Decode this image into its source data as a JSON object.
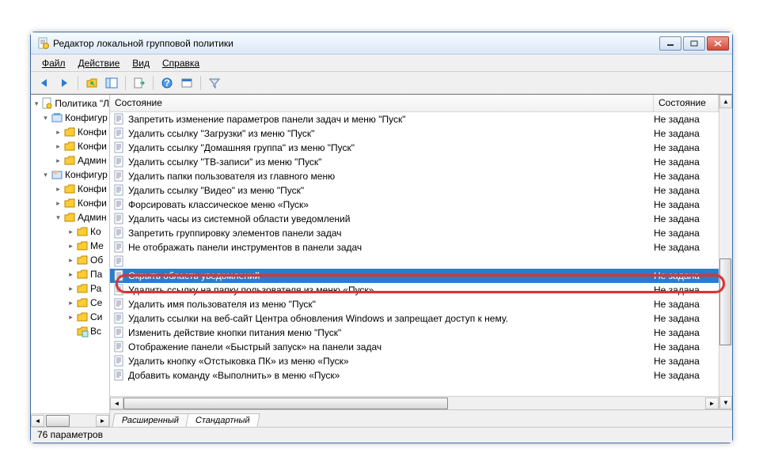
{
  "window": {
    "title": "Редактор локальной групповой политики"
  },
  "menu": {
    "file": "Файл",
    "action": "Действие",
    "view": "Вид",
    "help": "Справка"
  },
  "icons": {
    "back": "back",
    "fwd": "fwd",
    "up": "up",
    "props": "props",
    "refresh": "refresh",
    "export": "export",
    "help": "help",
    "run": "run",
    "filter": "filter"
  },
  "tree": {
    "root": "Политика \"Л",
    "nodes": [
      {
        "level": 1,
        "exp": "▾",
        "icon": "cfg",
        "label": "Конфигур"
      },
      {
        "level": 2,
        "exp": "▸",
        "icon": "folder",
        "label": "Конфи"
      },
      {
        "level": 2,
        "exp": "▸",
        "icon": "folder",
        "label": "Конфи"
      },
      {
        "level": 2,
        "exp": "▸",
        "icon": "folder",
        "label": "Админ"
      },
      {
        "level": 1,
        "exp": "▾",
        "icon": "cfg2",
        "label": "Конфигур"
      },
      {
        "level": 2,
        "exp": "▸",
        "icon": "folder",
        "label": "Конфи"
      },
      {
        "level": 2,
        "exp": "▸",
        "icon": "folder",
        "label": "Конфи"
      },
      {
        "level": 2,
        "exp": "▾",
        "icon": "folder",
        "label": "Админ"
      },
      {
        "level": 3,
        "exp": "▸",
        "icon": "folder",
        "label": "Ко"
      },
      {
        "level": 3,
        "exp": "▸",
        "icon": "folder",
        "label": "Ме"
      },
      {
        "level": 3,
        "exp": "▸",
        "icon": "folder",
        "label": "Об"
      },
      {
        "level": 3,
        "exp": "▸",
        "icon": "folder",
        "label": "Па"
      },
      {
        "level": 3,
        "exp": "▸",
        "icon": "folder",
        "label": "Ра"
      },
      {
        "level": 3,
        "exp": "▸",
        "icon": "folder",
        "label": "Се"
      },
      {
        "level": 3,
        "exp": "▸",
        "icon": "folder",
        "label": "Си"
      },
      {
        "level": 3,
        "exp": "",
        "icon": "folderx",
        "label": "Вс"
      }
    ]
  },
  "list": {
    "col_name": "Состояние",
    "col_state": "Состояние",
    "rows": [
      {
        "name": "Запретить изменение параметров панели задач и меню \"Пуск\"",
        "state": "Не задана"
      },
      {
        "name": "Удалить ссылку \"Загрузки\" из меню \"Пуск\"",
        "state": "Не задана"
      },
      {
        "name": "Удалить ссылку \"Домашняя группа\" из меню \"Пуск\"",
        "state": "Не задана"
      },
      {
        "name": "Удалить ссылку \"ТВ-записи\" из меню \"Пуск\"",
        "state": "Не задана"
      },
      {
        "name": "Удалить папки пользователя из главного меню",
        "state": "Не задана"
      },
      {
        "name": "Удалить ссылку \"Видео\" из меню \"Пуск\"",
        "state": "Не задана"
      },
      {
        "name": "Форсировать классическое меню «Пуск»",
        "state": "Не задана"
      },
      {
        "name": "Удалить часы из системной области уведомлений",
        "state": "Не задана"
      },
      {
        "name": "Запретить группировку элементов панели задач",
        "state": "Не задана"
      },
      {
        "name": "Не отображать панели инструментов в панели задач",
        "state": "Не задана"
      },
      {
        "name": "",
        "state": ""
      },
      {
        "name": "Скрыть область уведомлений",
        "state": "Не задана",
        "selected": true
      },
      {
        "name": "Удалить ссылку на папку пользователя из меню «Пуск»",
        "state": "Не задана"
      },
      {
        "name": "Удалить имя пользователя из меню \"Пуск\"",
        "state": "Не задана"
      },
      {
        "name": "Удалить ссылки на веб-сайт Центра обновления Windows и запрещает доступ к нему.",
        "state": "Не задана"
      },
      {
        "name": "Изменить действие кнопки питания меню \"Пуск\"",
        "state": "Не задана"
      },
      {
        "name": "Отображение панели «Быстрый запуск» на панели задач",
        "state": "Не задана"
      },
      {
        "name": "Удалить кнопку «Отстыковка ПК» из меню «Пуск»",
        "state": "Не задана"
      },
      {
        "name": "Добавить команду «Выполнить» в меню «Пуск»",
        "state": "Не задана"
      }
    ]
  },
  "tabs": {
    "extended": "Расширенный",
    "standard": "Стандартный"
  },
  "status": {
    "text": "76 параметров"
  }
}
